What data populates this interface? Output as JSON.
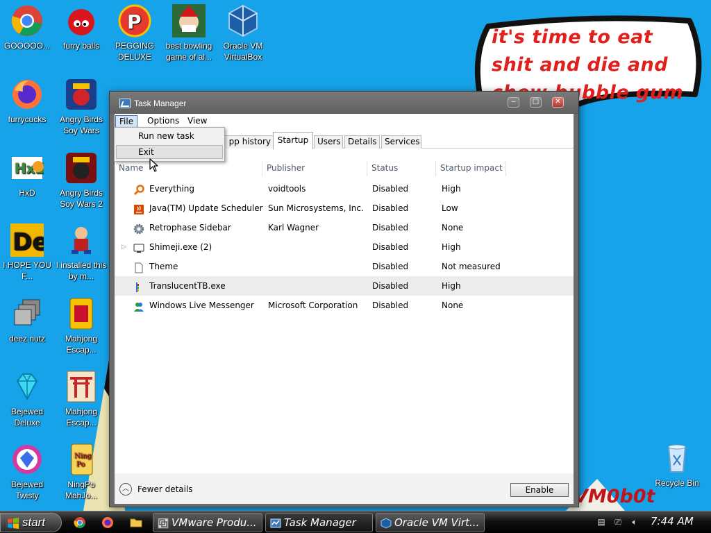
{
  "wallpaper": {
    "speech_text": "it's time to eat shit and die and chew bubble gum",
    "signature": "VM0b0t"
  },
  "desktop_icons": [
    {
      "label": "GOOOOO...",
      "icon": "chrome-icon"
    },
    {
      "label": "furry balls",
      "icon": "red-fuzzball-icon"
    },
    {
      "label": "PEGGING DELUXE",
      "icon": "peggle-icon"
    },
    {
      "label": "best bowling game of al...",
      "icon": "bowling-santa-icon"
    },
    {
      "label": "Oracle VM VirtualBox",
      "icon": "virtualbox-icon"
    },
    {
      "label": "furrycucks",
      "icon": "firefox-icon"
    },
    {
      "label": "Angry Birds Soy Wars",
      "icon": "angry-birds-star-wars-icon"
    },
    {
      "label": "HxD",
      "icon": "hxd-icon"
    },
    {
      "label": "Angry Birds Soy Wars 2",
      "icon": "angry-birds-star-wars-2-icon"
    },
    {
      "label": "I HOPE YOU F...",
      "icon": "de-icon"
    },
    {
      "label": "I installed this by m...",
      "icon": "cartoon-character-icon"
    },
    {
      "label": "deez nutz",
      "icon": "stacked-windows-icon"
    },
    {
      "label": "Mahjong Escap...",
      "icon": "mahjong-tile-icon"
    },
    {
      "label": "Bejewed Deluxe",
      "icon": "diamond-gem-icon"
    },
    {
      "label": "Mahjong Escap...",
      "icon": "torii-gate-icon"
    },
    {
      "label": "Bejewed Twisty",
      "icon": "bejeweled-twist-icon"
    },
    {
      "label": "NingPo MahJo...",
      "icon": "ningpo-icon"
    },
    {
      "label": "Recycle Bin",
      "icon": "recycle-bin-icon"
    }
  ],
  "task_manager": {
    "title": "Task Manager",
    "menus": [
      "File",
      "Options",
      "View"
    ],
    "file_menu": {
      "items": [
        "Run new task",
        "Exit"
      ],
      "highlighted": "Exit"
    },
    "tabs": [
      {
        "label": "pp history",
        "active": false
      },
      {
        "label": "Startup",
        "active": true
      },
      {
        "label": "Users",
        "active": false
      },
      {
        "label": "Details",
        "active": false
      },
      {
        "label": "Services",
        "active": false
      }
    ],
    "columns": [
      "Name",
      "Publisher",
      "Status",
      "Startup impact"
    ],
    "rows": [
      {
        "name": "Everything",
        "publisher": "voidtools",
        "status": "Disabled",
        "impact": "High",
        "icon": "magnifier-icon",
        "expandable": false,
        "selected": false
      },
      {
        "name": "Java(TM) Update Scheduler",
        "publisher": "Sun Microsystems, Inc.",
        "status": "Disabled",
        "impact": "Low",
        "icon": "java-icon",
        "expandable": false,
        "selected": false
      },
      {
        "name": "Retrophase Sidebar",
        "publisher": "Karl Wagner",
        "status": "Disabled",
        "impact": "None",
        "icon": "gear-icon",
        "expandable": false,
        "selected": false
      },
      {
        "name": "Shimeji.exe (2)",
        "publisher": "",
        "status": "Disabled",
        "impact": "High",
        "icon": "monitor-icon",
        "expandable": true,
        "selected": false
      },
      {
        "name": "Theme",
        "publisher": "",
        "status": "Disabled",
        "impact": "Not measured",
        "icon": "blank-file-icon",
        "expandable": false,
        "selected": false
      },
      {
        "name": "TranslucentTB.exe",
        "publisher": "",
        "status": "Disabled",
        "impact": "High",
        "icon": "translucenttb-icon",
        "expandable": false,
        "selected": true
      },
      {
        "name": "Windows Live Messenger",
        "publisher": "Microsoft Corporation",
        "status": "Disabled",
        "impact": "None",
        "icon": "messenger-icon",
        "expandable": false,
        "selected": false
      }
    ],
    "footer": {
      "fewer_details": "Fewer details",
      "enable_button": "Enable"
    }
  },
  "taskbar": {
    "start_label": "start",
    "quick_launch": [
      "chrome-icon",
      "firefox-icon",
      "folder-icon"
    ],
    "buttons": [
      {
        "label": "VMware Produ...",
        "icon": "vmware-icon"
      },
      {
        "label": "Task Manager",
        "icon": "task-manager-icon"
      },
      {
        "label": "Oracle VM Virt...",
        "icon": "virtualbox-icon"
      }
    ],
    "tray_icons": [
      "notification-icon",
      "network-icon",
      "volume-icon"
    ],
    "clock": "7:44 AM"
  },
  "colors": {
    "desktop_bg": "#16a3ea",
    "speech_text": "#e0201c",
    "window_frame": "#6b6b6b",
    "selected_row": "#ececec"
  }
}
